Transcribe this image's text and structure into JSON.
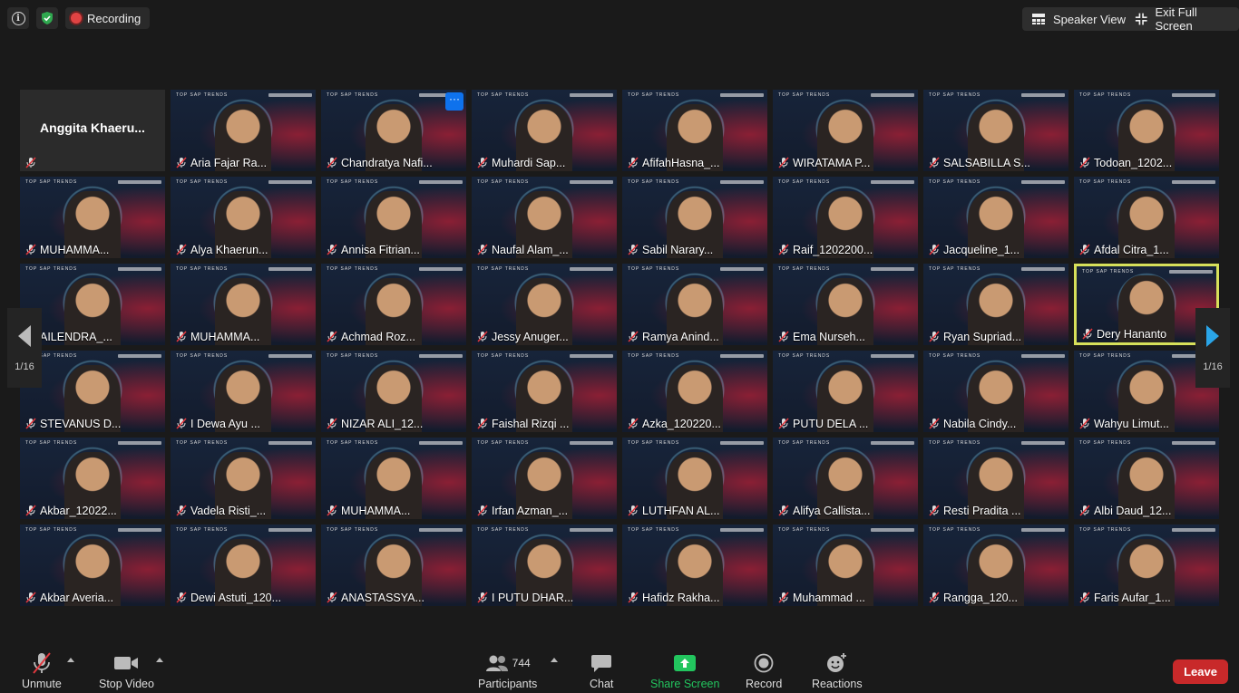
{
  "topbar": {
    "recording_label": "Recording",
    "speaker_view_label": "Speaker View",
    "exit_fullscreen_label": "Exit Full Screen",
    "shield_color": "#2fa84f"
  },
  "gallery": {
    "page_indicator_left": "1/16",
    "page_indicator_right": "1/16",
    "tiles": [
      {
        "name": "Anggita  Khaeru..."
      },
      {
        "name": "Aria Fajar Ra..."
      },
      {
        "name": "Chandratya Nafi..."
      },
      {
        "name": "Muhardi Sap..."
      },
      {
        "name": "AfifahHasna_..."
      },
      {
        "name": "WIRATAMA P..."
      },
      {
        "name": "SALSABILLA S..."
      },
      {
        "name": "Todoan_1202..."
      },
      {
        "name": "MUHAMMA..."
      },
      {
        "name": "Alya Khaerun..."
      },
      {
        "name": "Annisa Fitrian..."
      },
      {
        "name": "Naufal Alam_..."
      },
      {
        "name": "Sabil Narary..."
      },
      {
        "name": "Raif_1202200..."
      },
      {
        "name": "Jacqueline_1..."
      },
      {
        "name": "Afdal Citra_1..."
      },
      {
        "name": "AILENDRA_..."
      },
      {
        "name": "MUHAMMA..."
      },
      {
        "name": "Achmad Roz..."
      },
      {
        "name": "Jessy Anuger..."
      },
      {
        "name": "Ramya Anind..."
      },
      {
        "name": "Ema Nurseh..."
      },
      {
        "name": "Ryan Supriad..."
      },
      {
        "name": "Dery Hananto"
      },
      {
        "name": "STEVANUS D..."
      },
      {
        "name": "I Dewa Ayu ..."
      },
      {
        "name": "NIZAR ALI_12..."
      },
      {
        "name": "Faishal Rizqi ..."
      },
      {
        "name": "Azka_120220..."
      },
      {
        "name": "PUTU DELA ..."
      },
      {
        "name": "Nabila Cindy..."
      },
      {
        "name": "Wahyu Limut..."
      },
      {
        "name": "Akbar_12022..."
      },
      {
        "name": "Vadela Risti_..."
      },
      {
        "name": "MUHAMMA..."
      },
      {
        "name": "Irfan Azman_..."
      },
      {
        "name": "LUTHFAN AL..."
      },
      {
        "name": "Alifya Callista..."
      },
      {
        "name": "Resti Pradita ..."
      },
      {
        "name": "Albi Daud_12..."
      },
      {
        "name": "Akbar Averia..."
      },
      {
        "name": "Dewi Astuti_120..."
      },
      {
        "name": "ANASTASSYA..."
      },
      {
        "name": "I PUTU DHAR..."
      },
      {
        "name": "Hafidz Rakha..."
      },
      {
        "name": "Muhammad ..."
      },
      {
        "name": "Rangga_120..."
      },
      {
        "name": "Faris Aufar_1..."
      }
    ],
    "background_brand": "TOP SAP TRENDS",
    "active_speaker_color": "#d7e05a"
  },
  "toolbar": {
    "unmute_label": "Unmute",
    "stop_video_label": "Stop Video",
    "participants_count": "744",
    "participants_label": "Participants",
    "chat_label": "Chat",
    "share_screen_label": "Share Screen",
    "record_label": "Record",
    "reactions_label": "Reactions",
    "leave_label": "Leave",
    "share_color": "#22c55e",
    "leave_color": "#c8292a"
  }
}
